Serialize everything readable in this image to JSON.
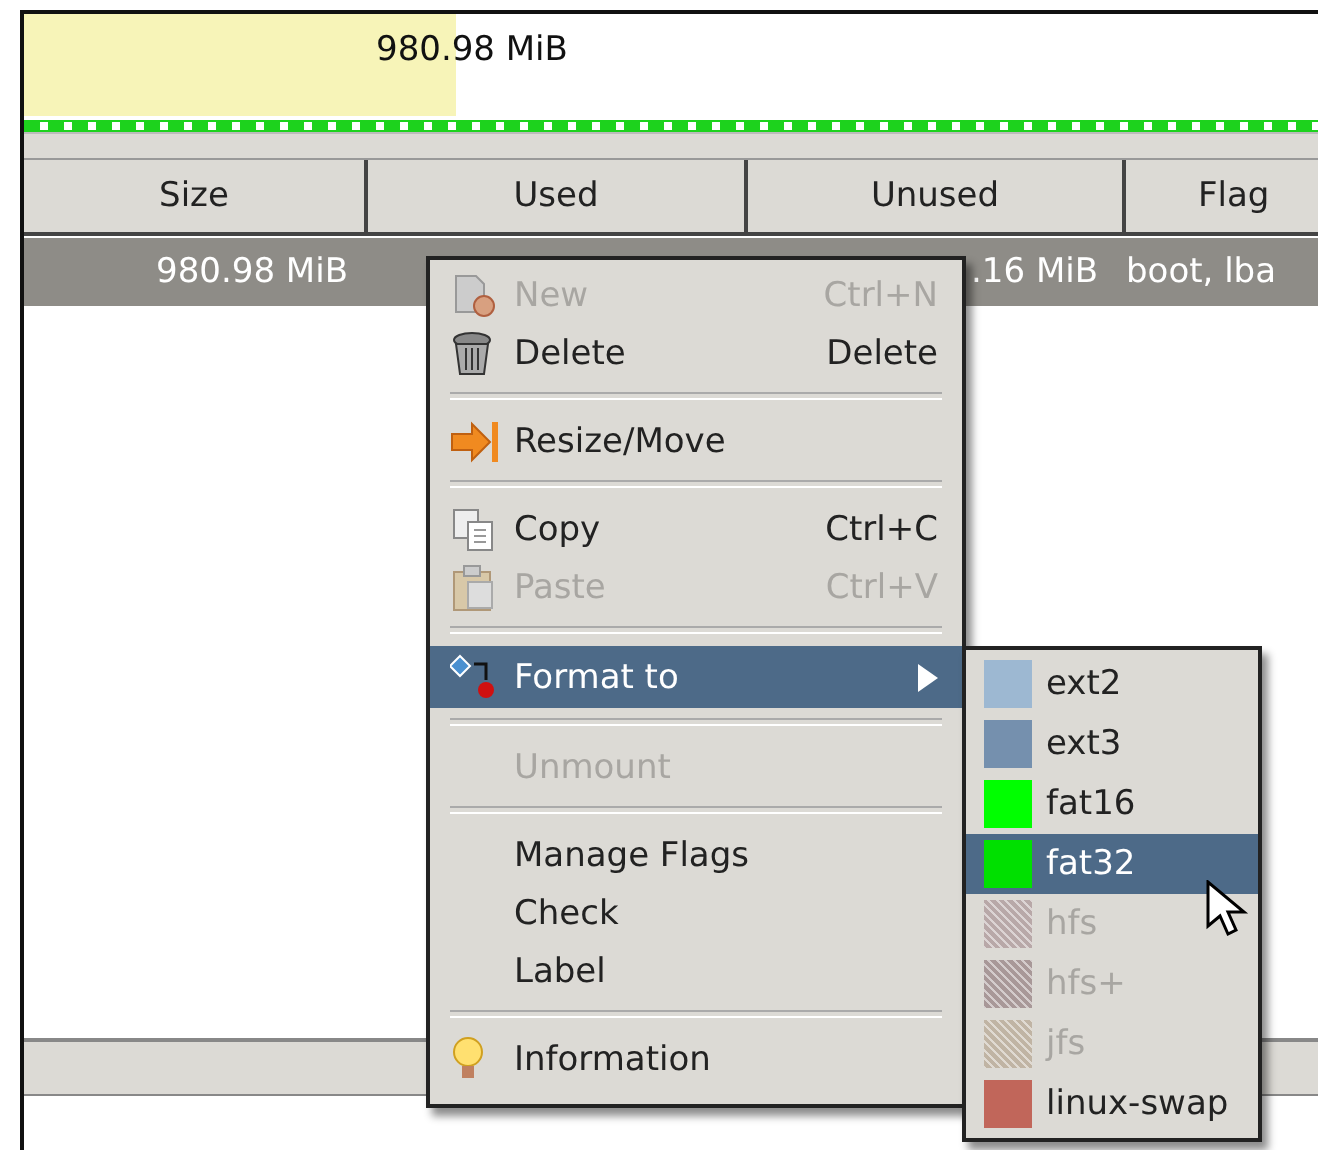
{
  "partition_map": {
    "size": "980.98 MiB"
  },
  "table": {
    "columns": [
      "Size",
      "Used",
      "Unused",
      "Flag"
    ],
    "rows": [
      {
        "selected": true,
        "cells": [
          "980.98 MiB",
          "",
          ".16 MiB",
          "boot, lba"
        ]
      }
    ]
  },
  "context_menu": {
    "items": [
      {
        "kind": "item",
        "label": "New",
        "shortcut": "Ctrl+N",
        "disabled": true,
        "selected": false
      },
      {
        "kind": "item",
        "label": "Delete",
        "shortcut": "Delete",
        "disabled": false,
        "selected": false
      },
      {
        "kind": "separator"
      },
      {
        "kind": "item",
        "label": "Resize/Move",
        "disabled": false,
        "selected": false
      },
      {
        "kind": "separator"
      },
      {
        "kind": "item",
        "label": "Copy",
        "shortcut": "Ctrl+C",
        "disabled": false,
        "selected": false
      },
      {
        "kind": "item",
        "label": "Paste",
        "shortcut": "Ctrl+V",
        "disabled": true,
        "selected": false
      },
      {
        "kind": "separator"
      },
      {
        "kind": "submenu",
        "label": "Format to",
        "disabled": false,
        "selected": true
      },
      {
        "kind": "separator"
      },
      {
        "kind": "item",
        "label": "Unmount",
        "disabled": true,
        "selected": false
      },
      {
        "kind": "separator"
      },
      {
        "kind": "item",
        "label": "Manage Flags",
        "disabled": false,
        "selected": false
      },
      {
        "kind": "item",
        "label": "Check",
        "disabled": false,
        "selected": false
      },
      {
        "kind": "item",
        "label": "Label",
        "disabled": false,
        "selected": false
      },
      {
        "kind": "separator"
      },
      {
        "kind": "item",
        "label": "Information",
        "disabled": false,
        "selected": false
      }
    ]
  },
  "format_submenu": {
    "items": [
      {
        "label": "ext2",
        "color": "#9db8d2",
        "disabled": false,
        "selected": false
      },
      {
        "label": "ext3",
        "color": "#7590ae",
        "disabled": false,
        "selected": false
      },
      {
        "label": "fat16",
        "color": "#00ff00",
        "disabled": false,
        "selected": false
      },
      {
        "label": "fat32",
        "color": "#00e000",
        "disabled": false,
        "selected": true
      },
      {
        "label": "hfs",
        "color": "#b8a8a8",
        "disabled": true,
        "selected": false
      },
      {
        "label": "hfs+",
        "color": "#a89898",
        "disabled": true,
        "selected": false
      },
      {
        "label": "jfs",
        "color": "#c0b4a4",
        "disabled": true,
        "selected": false
      },
      {
        "label": "linux-swap",
        "color": "#c1665a",
        "disabled": false,
        "selected": false
      }
    ]
  }
}
